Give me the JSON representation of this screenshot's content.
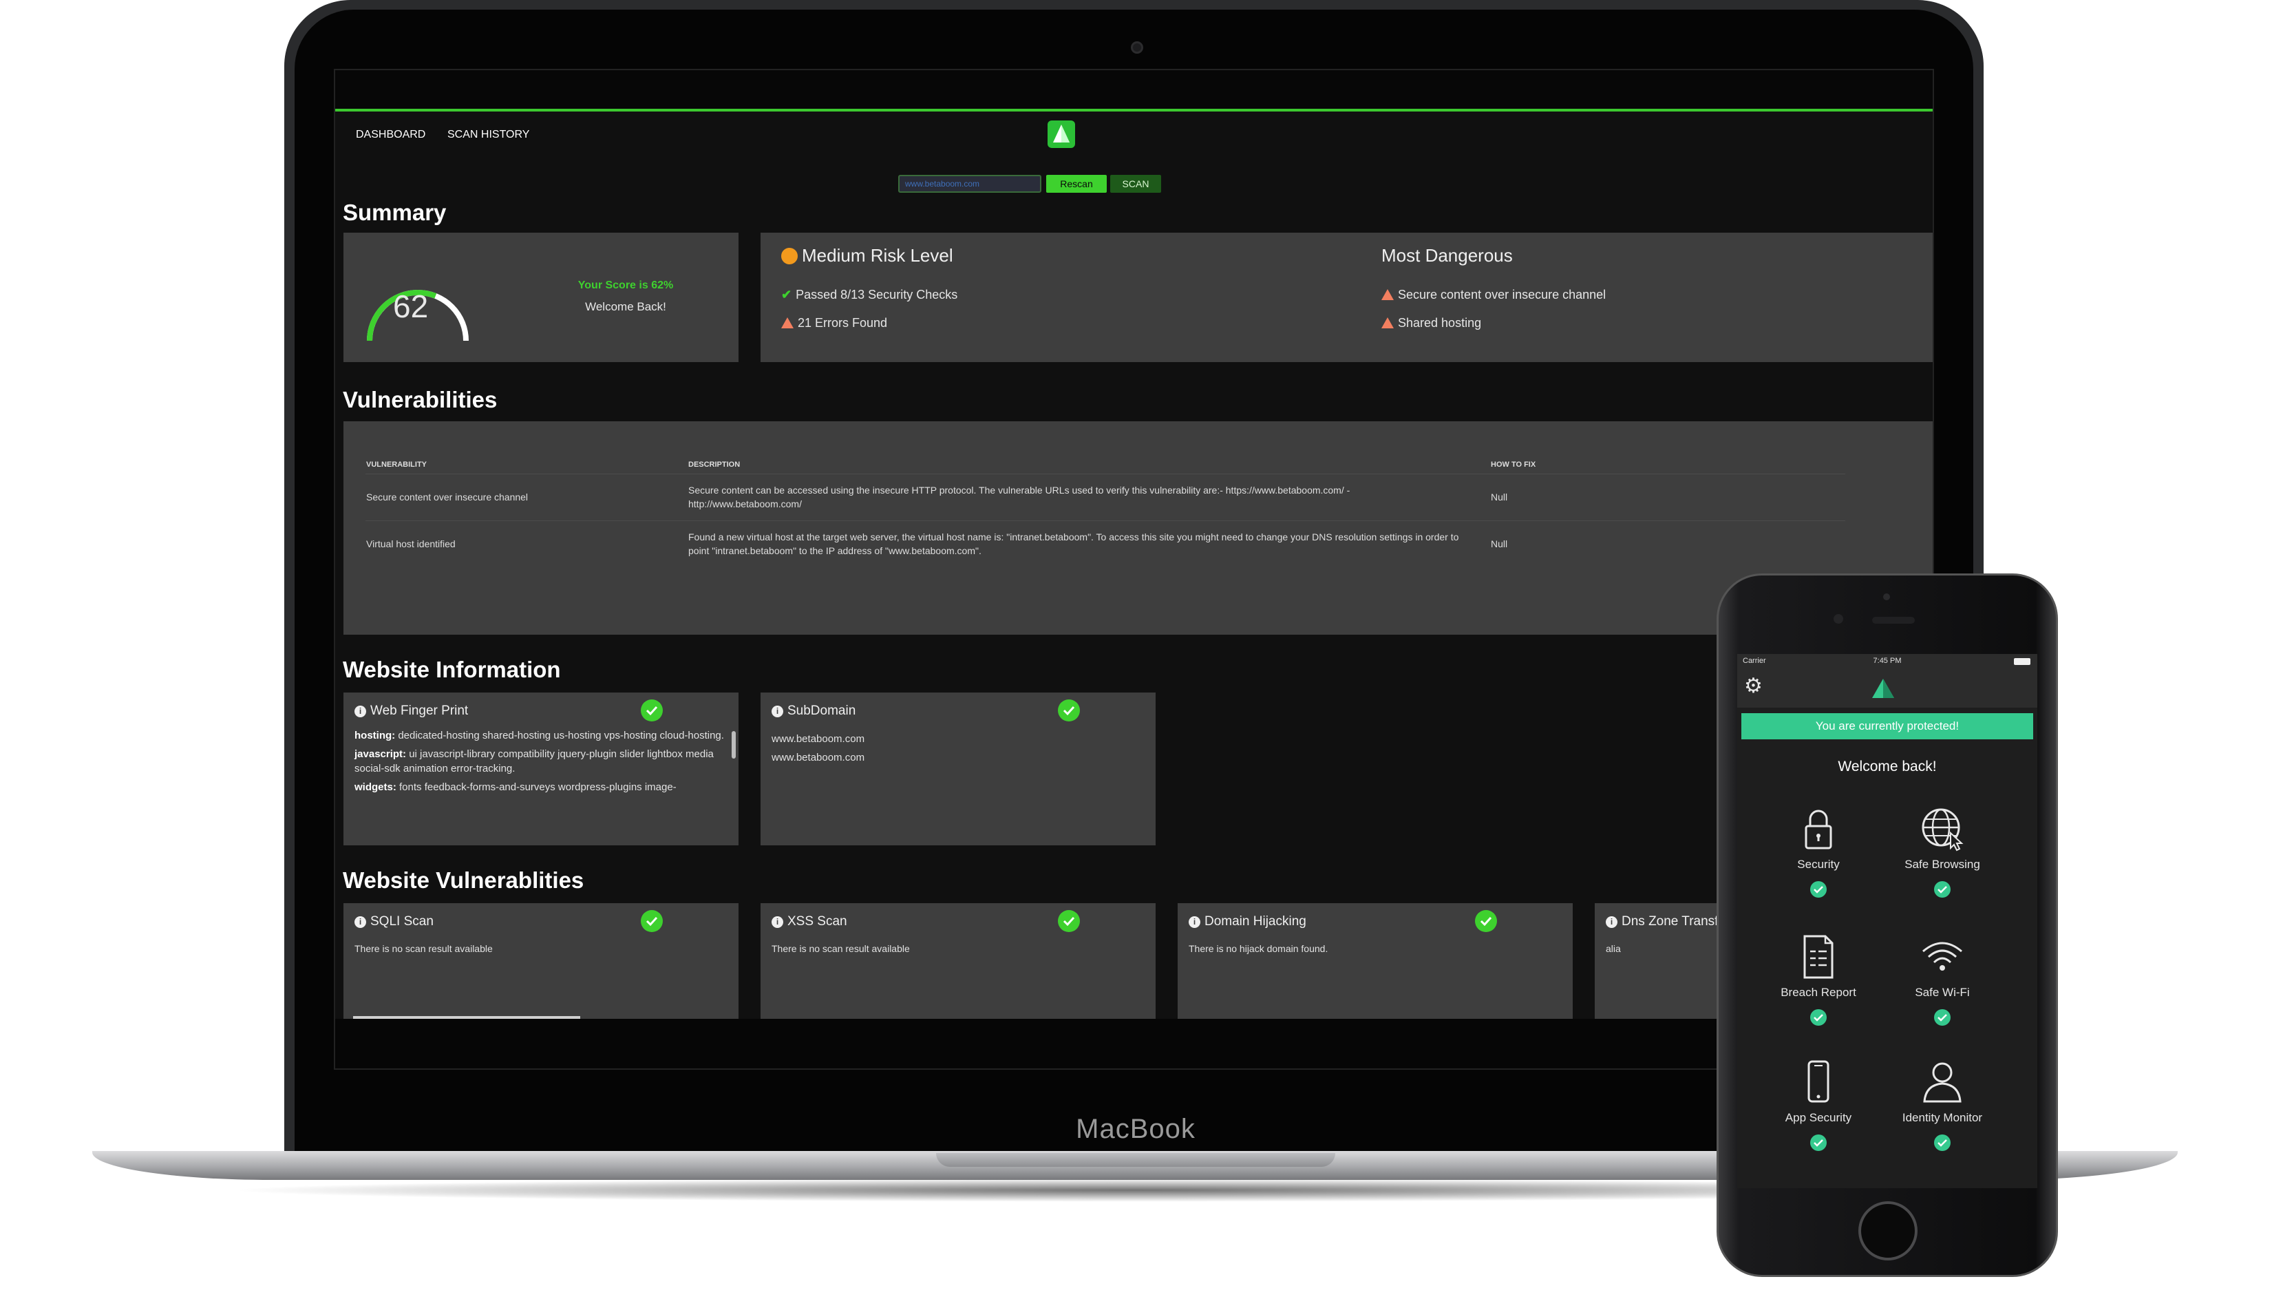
{
  "laptop": {
    "brand": "MacBook"
  },
  "nav": {
    "dashboard": "DASHBOARD",
    "scan_history": "SCAN HISTORY"
  },
  "search": {
    "value": "www.betaboom.com",
    "rescan_label": "Rescan",
    "scan_label": "SCAN"
  },
  "summary": {
    "title": "Summary",
    "score": "62",
    "score_text": "Your Score is 62%",
    "welcome": "Welcome Back!",
    "risk_level": "Medium Risk Level",
    "passed": "Passed 8/13 Security Checks",
    "errors": "21 Errors Found",
    "most_dangerous_title": "Most Dangerous",
    "dangers": [
      "Secure content over insecure channel",
      "Shared hosting"
    ]
  },
  "vulnerabilities": {
    "title": "Vulnerabilities",
    "columns": [
      "VULNERABILITY",
      "DESCRIPTION",
      "HOW TO FIX"
    ],
    "rows": [
      {
        "name": "Secure content over insecure channel",
        "description": "Secure content can be accessed using the insecure HTTP protocol. The vulnerable URLs used to verify this vulnerability are:- https://www.betaboom.com/ - http://www.betaboom.com/",
        "fix": "Null"
      },
      {
        "name": "Virtual host identified",
        "description": "Found a new virtual host at the target web server, the virtual host name is: \"intranet.betaboom\". To access this site you might need to change your DNS resolution settings in order to point \"intranet.betaboom\" to the IP address of \"www.betaboom.com\".",
        "fix": "Null"
      }
    ]
  },
  "website_info": {
    "title": "Website Information",
    "fingerprint": {
      "title": "Web Finger Print",
      "hosting_key": "hosting:",
      "hosting": " dedicated-hosting shared-hosting us-hosting vps-hosting cloud-hosting.",
      "javascript_key": "javascript:",
      "javascript": " ui javascript-library compatibility jquery-plugin slider lightbox media social-sdk animation error-tracking.",
      "widgets_key": "widgets:",
      "widgets": " fonts feedback-forms-and-surveys wordpress-plugins image-"
    },
    "subdomain": {
      "title": "SubDomain",
      "items": [
        "www.betaboom.com",
        "www.betaboom.com"
      ]
    }
  },
  "website_vulns": {
    "title": "Website Vulnerablities",
    "cards": [
      {
        "title": "SQLI Scan",
        "text": "There is no scan result available"
      },
      {
        "title": "XSS Scan",
        "text": "There is no scan result available"
      },
      {
        "title": "Domain Hijacking",
        "text": "There is no hijack domain found."
      },
      {
        "title": "Dns Zone Transfe",
        "text": "alia"
      }
    ]
  },
  "phone": {
    "carrier": "Carrier",
    "time": "7:45 PM",
    "banner": "You are currently protected!",
    "welcome": "Welcome back!",
    "features": [
      {
        "label": "Security",
        "icon": "lock-icon"
      },
      {
        "label": "Safe Browsing",
        "icon": "globe-icon"
      },
      {
        "label": "Breach Report",
        "icon": "report-icon"
      },
      {
        "label": "Safe Wi-Fi",
        "icon": "wifi-icon"
      },
      {
        "label": "App Security",
        "icon": "smartphone-icon"
      },
      {
        "label": "Identity Monitor",
        "icon": "person-icon"
      }
    ]
  },
  "colors": {
    "accent_green": "#3ed12e",
    "teal": "#35c98e",
    "warning_orange": "#f39a1d",
    "panel": "#3e3e3e"
  }
}
